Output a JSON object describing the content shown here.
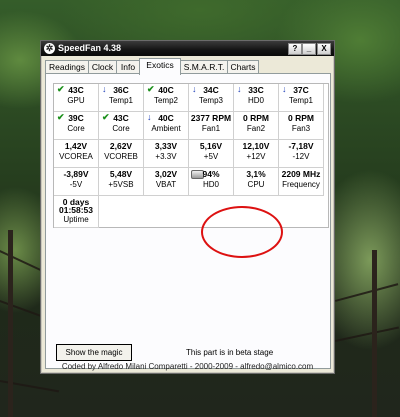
{
  "window": {
    "title": "SpeedFan 4.38",
    "buttons": {
      "help": "?",
      "minimize": "_",
      "close": "X"
    }
  },
  "tabs": [
    {
      "label": "Readings"
    },
    {
      "label": "Clock"
    },
    {
      "label": "Info"
    },
    {
      "label": "Exotics",
      "active": true
    },
    {
      "label": "S.M.A.R.T."
    },
    {
      "label": "Charts"
    }
  ],
  "grid": {
    "rows": [
      [
        {
          "icon": "check-icon",
          "value": "43C",
          "label": "GPU"
        },
        {
          "icon": "down-arrow-icon",
          "value": "36C",
          "label": "Temp1"
        },
        {
          "icon": "check-icon",
          "value": "40C",
          "label": "Temp2"
        },
        {
          "icon": "down-arrow-icon",
          "value": "34C",
          "label": "Temp3"
        },
        {
          "icon": "down-arrow-icon",
          "value": "33C",
          "label": "HD0"
        },
        {
          "icon": "down-arrow-icon",
          "value": "37C",
          "label": "Temp1"
        }
      ],
      [
        {
          "icon": "check-icon",
          "value": "39C",
          "label": "Core"
        },
        {
          "icon": "check-icon",
          "value": "43C",
          "label": "Core"
        },
        {
          "icon": "down-arrow-icon",
          "value": "40C",
          "label": "Ambient"
        },
        {
          "icon": "",
          "value": "2377 RPM",
          "label": "Fan1"
        },
        {
          "icon": "",
          "value": "0 RPM",
          "label": "Fan2"
        },
        {
          "icon": "",
          "value": "0 RPM",
          "label": "Fan3"
        }
      ],
      [
        {
          "icon": "",
          "value": "1,42V",
          "label": "VCOREA"
        },
        {
          "icon": "",
          "value": "2,62V",
          "label": "VCOREB"
        },
        {
          "icon": "",
          "value": "3,33V",
          "label": "+3.3V"
        },
        {
          "icon": "",
          "value": "5,16V",
          "label": "+5V"
        },
        {
          "icon": "",
          "value": "12,10V",
          "label": "+12V"
        },
        {
          "icon": "",
          "value": "-7,18V",
          "label": "-12V"
        }
      ],
      [
        {
          "icon": "",
          "value": "-3,89V",
          "label": "-5V"
        },
        {
          "icon": "",
          "value": "5,48V",
          "label": "+5VSB"
        },
        {
          "icon": "",
          "value": "3,02V",
          "label": "VBAT"
        },
        {
          "icon": "hard-drive-icon",
          "value": "94%",
          "label": "HD0"
        },
        {
          "icon": "",
          "value": "3,1%",
          "label": "CPU"
        },
        {
          "icon": "",
          "value": "2209 MHz",
          "label": "Frequency"
        }
      ],
      [
        {
          "icon": "",
          "value": "0 days",
          "value2": "01:58:53",
          "label": "Uptime"
        }
      ]
    ]
  },
  "buttons": {
    "show_magic": "Show the magic"
  },
  "beta_text": "This part is in beta stage",
  "footer": "Coded by Alfredo Milani Comparetti - 2000-2009 - alfredo@almico.com",
  "colors": {
    "annotation_circle": "#dd1111",
    "check": "#1a8f1a",
    "arrow": "#1f3fb8"
  }
}
